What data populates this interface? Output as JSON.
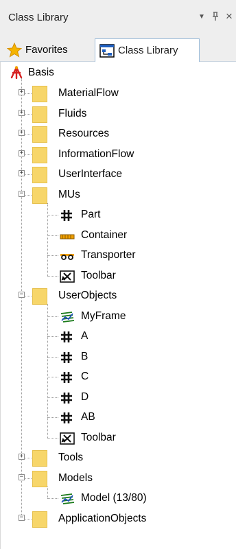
{
  "window": {
    "title": "Class Library",
    "pin_glyph": "ꟹ",
    "close_glyph": "×",
    "menu_glyph": "▼"
  },
  "tabs": [
    {
      "label": "Favorites",
      "icon": "star-icon",
      "active": false
    },
    {
      "label": "Class Library",
      "icon": "class-library-icon",
      "active": true
    }
  ],
  "tree": {
    "root": {
      "label": "Basis",
      "icon": "basis-root-icon"
    },
    "items": [
      {
        "label": "MaterialFlow",
        "type": "folder",
        "expander": "+"
      },
      {
        "label": "Fluids",
        "type": "folder",
        "expander": "+"
      },
      {
        "label": "Resources",
        "type": "folder",
        "expander": "+"
      },
      {
        "label": "InformationFlow",
        "type": "folder",
        "expander": "+"
      },
      {
        "label": "UserInterface",
        "type": "folder",
        "expander": "+"
      },
      {
        "label": "MUs",
        "type": "folder",
        "expander": "−"
      },
      {
        "label": "Part",
        "type": "part",
        "icon": "part-grid-icon"
      },
      {
        "label": "Container",
        "type": "container",
        "icon": "container-icon"
      },
      {
        "label": "Transporter",
        "type": "transporter",
        "icon": "transporter-icon"
      },
      {
        "label": "Toolbar",
        "type": "toolbar",
        "icon": "toolbar-icon"
      },
      {
        "label": "UserObjects",
        "type": "folder",
        "expander": "−"
      },
      {
        "label": "MyFrame",
        "type": "frame",
        "icon": "frame-icon"
      },
      {
        "label": "A",
        "type": "part",
        "icon": "part-grid-icon"
      },
      {
        "label": "B",
        "type": "part",
        "icon": "part-grid-icon"
      },
      {
        "label": "C",
        "type": "part",
        "icon": "part-grid-icon"
      },
      {
        "label": "D",
        "type": "part",
        "icon": "part-grid-icon"
      },
      {
        "label": "AB",
        "type": "part",
        "icon": "part-grid-icon"
      },
      {
        "label": "Toolbar",
        "type": "toolbar",
        "icon": "toolbar-icon"
      },
      {
        "label": "Tools",
        "type": "folder",
        "expander": "+"
      },
      {
        "label": "Models",
        "type": "folder",
        "expander": "−"
      },
      {
        "label": "Model (13/80)",
        "type": "frame",
        "icon": "frame-icon"
      },
      {
        "label": "ApplicationObjects",
        "type": "folder",
        "expander": "−"
      }
    ]
  },
  "colors": {
    "folder": "#f7d66a",
    "tab_border": "#9dbcd9",
    "chrome": "#eeeeee",
    "transporter_accent": "#f0a000"
  }
}
